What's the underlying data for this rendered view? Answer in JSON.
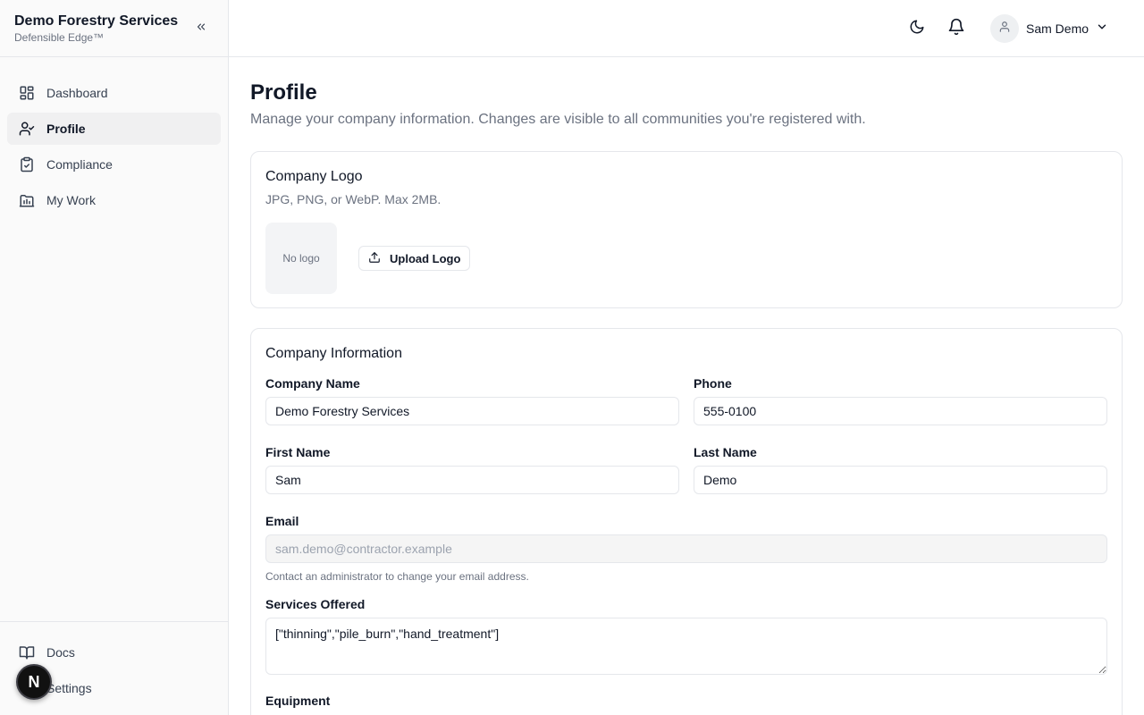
{
  "sidebar": {
    "brand_title": "Demo Forestry Services",
    "brand_subtitle": "Defensible Edge™",
    "nav": [
      {
        "label": "Dashboard",
        "icon": "dashboard-icon",
        "active": false
      },
      {
        "label": "Profile",
        "icon": "user-check-icon",
        "active": true
      },
      {
        "label": "Compliance",
        "icon": "clipboard-check-icon",
        "active": false
      },
      {
        "label": "My Work",
        "icon": "briefcase-chart-icon",
        "active": false
      }
    ],
    "footer": [
      {
        "label": "Docs",
        "icon": "book-open-icon"
      },
      {
        "label": "Settings",
        "icon": "settings-icon"
      }
    ],
    "fab_letter": "N"
  },
  "topbar": {
    "user_name": "Sam Demo"
  },
  "page": {
    "title": "Profile",
    "subtitle": "Manage your company information. Changes are visible to all communities you're registered with."
  },
  "logo_card": {
    "title": "Company Logo",
    "subtitle": "JPG, PNG, or WebP. Max 2MB.",
    "placeholder": "No logo",
    "upload_label": "Upload Logo"
  },
  "info_card": {
    "title": "Company Information",
    "company_name": {
      "label": "Company Name",
      "value": "Demo Forestry Services"
    },
    "phone": {
      "label": "Phone",
      "value": "555-0100"
    },
    "first_name": {
      "label": "First Name",
      "value": "Sam"
    },
    "last_name": {
      "label": "Last Name",
      "value": "Demo"
    },
    "email": {
      "label": "Email",
      "value": "sam.demo@contractor.example",
      "helper": "Contact an administrator to change your email address."
    },
    "services": {
      "label": "Services Offered",
      "value": "[\"thinning\",\"pile_burn\",\"hand_treatment\"]"
    },
    "equipment": {
      "label": "Equipment"
    }
  },
  "colors": {
    "sidebar_bg": "#fafafa",
    "active_nav_bg": "#f0f0f1",
    "border": "#e5e7eb",
    "muted_text": "#6b7280"
  }
}
